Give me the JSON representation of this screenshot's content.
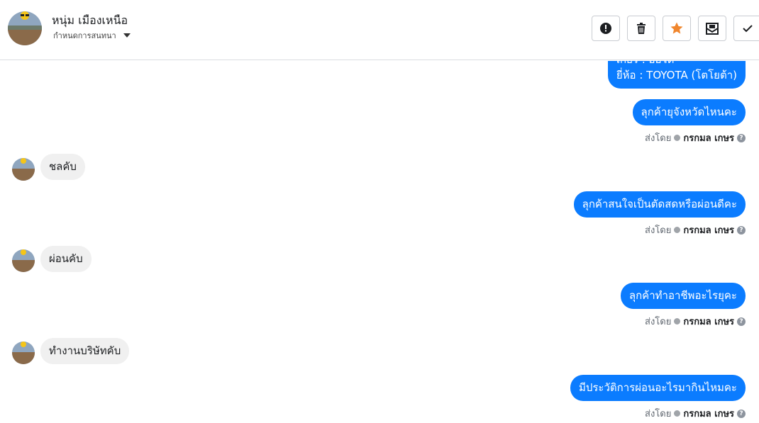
{
  "header": {
    "contact_name": "หนุ่ม เมืองเหนือ",
    "conversation_setting": "กำหนดการสนทนา",
    "actions": [
      {
        "name": "mark-spam",
        "icon": "exclamation-icon"
      },
      {
        "name": "delete",
        "icon": "trash-icon"
      },
      {
        "name": "star",
        "icon": "star-icon"
      },
      {
        "name": "mark-unread",
        "icon": "envelope-icon"
      },
      {
        "name": "mark-done",
        "icon": "check-icon"
      }
    ],
    "star_color": "#f0862d"
  },
  "thread": {
    "m0_line1": "เกียร์ : ออโต้",
    "m0_line2": "ยี่ห้อ : TOYOTA (โตโยต้า)",
    "m1": "ลุกค้ายุจังหวัดไหนคะ",
    "m2": "ชลคับ",
    "m3": "ลุกค้าสนใจเป็นตัดสดหรือผ่อนดีคะ",
    "m4": "ผ่อนคับ",
    "m5": "ลุกค้าทำอาชีพอะไรยุคะ",
    "m6": "ทำงานบริษัทคับ",
    "m7": "มีประวัติการผ่อนอะไรมากินไหมคะ",
    "sent_by_label": "ส่งโดย",
    "sent_by_agent": "กรกมล เกษร",
    "outgoing_color": "#0b7cff",
    "incoming_color": "#f0f0f0"
  }
}
